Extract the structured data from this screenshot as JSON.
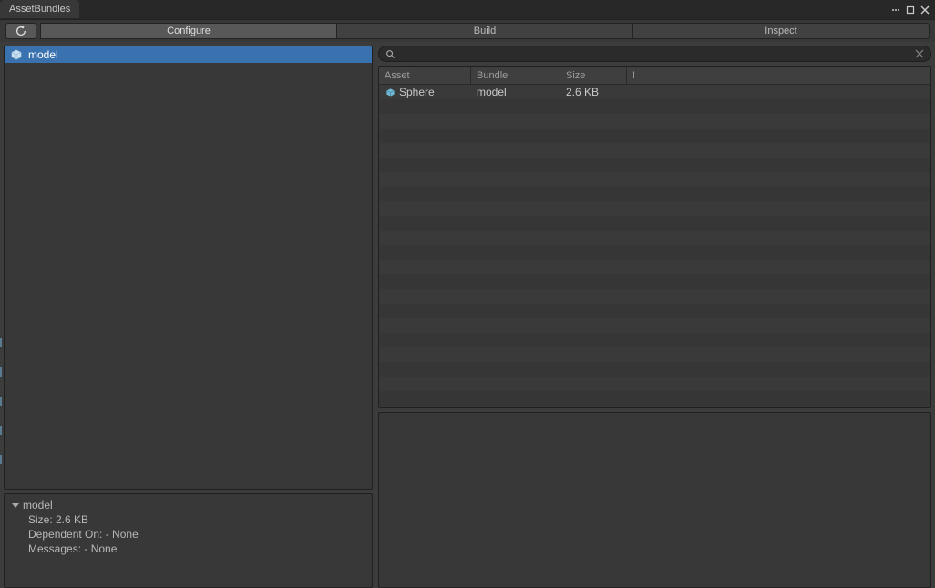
{
  "window": {
    "tab_title": "AssetBundles"
  },
  "tabs": {
    "configure": "Configure",
    "build": "Build",
    "inspect": "Inspect",
    "active": "Configure"
  },
  "search": {
    "value": "",
    "placeholder": ""
  },
  "bundles": [
    {
      "name": "model",
      "selected": true
    }
  ],
  "bundle_details": {
    "name": "model",
    "size_label": "Size: 2.6 KB",
    "dependent_label": "Dependent On: - None",
    "messages_label": "Messages: - None"
  },
  "asset_columns": {
    "asset": "Asset",
    "bundle": "Bundle",
    "size": "Size",
    "warn": "!"
  },
  "assets": [
    {
      "name": "Sphere",
      "bundle": "model",
      "size": "2.6 KB"
    }
  ]
}
